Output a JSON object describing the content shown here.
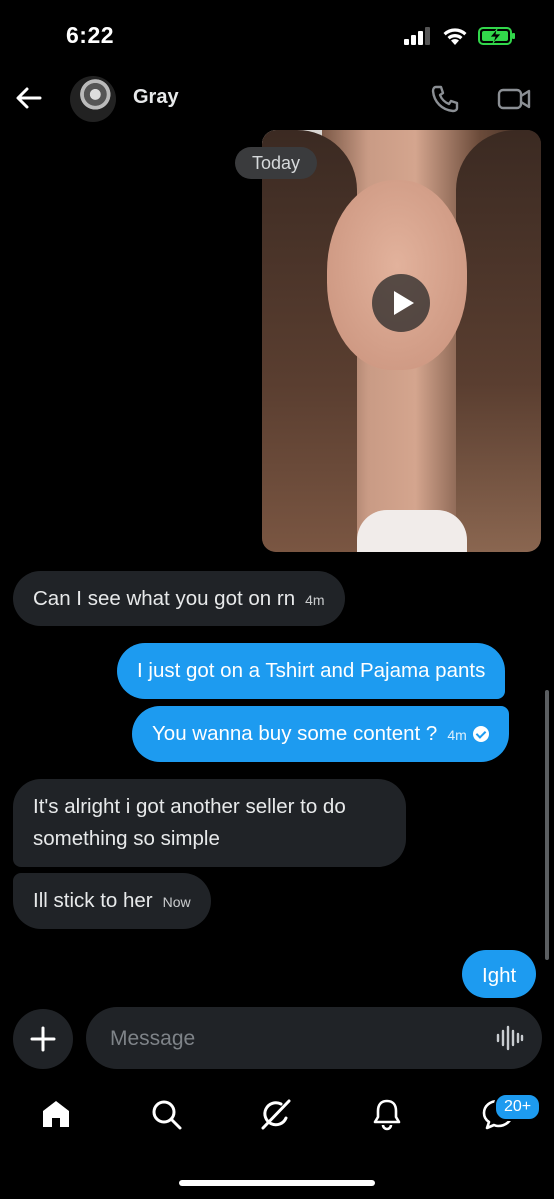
{
  "status_bar": {
    "time": "6:22"
  },
  "header": {
    "contact_name": "Gray"
  },
  "date_separator": "Today",
  "messages": [
    {
      "text": "Can I see what you got on rn",
      "time": "4m",
      "direction": "incoming"
    },
    {
      "text": "I just got on a Tshirt and Pajama pants",
      "direction": "outgoing"
    },
    {
      "text": "You wanna buy some content ?",
      "time": "4m",
      "direction": "outgoing",
      "status": "read-check-icon"
    },
    {
      "text": "It's alright i got another seller to do something so simple",
      "direction": "incoming"
    },
    {
      "text": "Ill stick to her",
      "time": "Now",
      "direction": "incoming"
    },
    {
      "text": "Ight",
      "direction": "outgoing"
    }
  ],
  "composer": {
    "placeholder": "Message"
  },
  "bottom_nav": {
    "messages_badge": "20+"
  },
  "colors": {
    "accent": "#1d9bf0",
    "incoming_bubble": "#202327",
    "background": "#000000"
  }
}
